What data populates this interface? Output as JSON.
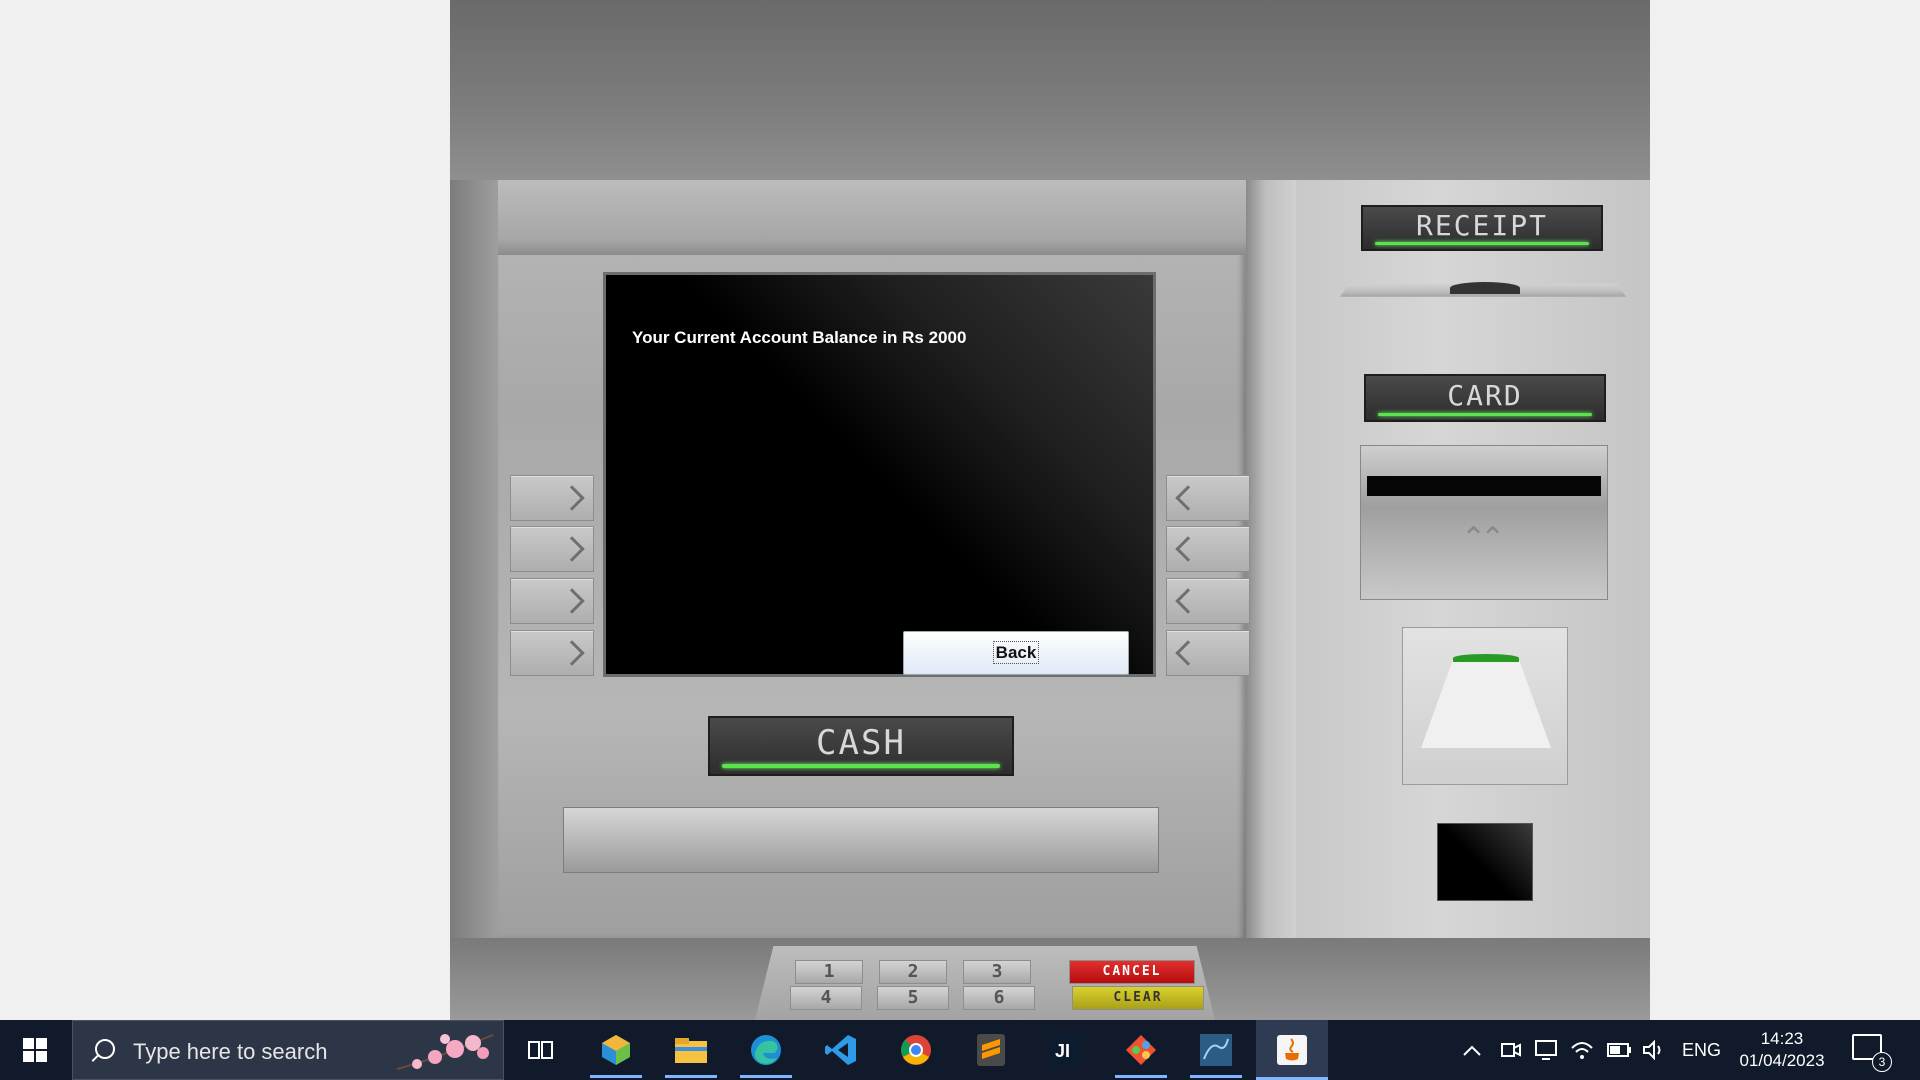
{
  "screen": {
    "message": "Your Current Account Balance in Rs 2000",
    "back_label": "Back"
  },
  "atm": {
    "receipt_label": "RECEIPT",
    "card_label": "CARD",
    "cash_label": "CASH",
    "keys": [
      "1",
      "2",
      "3",
      "4",
      "5",
      "6"
    ],
    "cancel_label": "CANCEL",
    "clear_label": "CLEAR",
    "accent_green": "#5ce24a"
  },
  "taskbar": {
    "search_placeholder": "Type here to search",
    "lang": "ENG",
    "time": "14:23",
    "date": "01/04/2023",
    "notification_count": "3",
    "apps": [
      "task-view",
      "netbeans",
      "file-explorer",
      "edge",
      "vscode",
      "chrome",
      "sublime",
      "intellij",
      "git",
      "mysql-workbench",
      "java"
    ]
  }
}
